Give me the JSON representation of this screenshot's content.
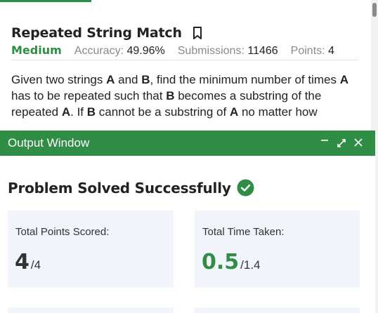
{
  "problem": {
    "title": "Repeated String Match",
    "difficulty": "Medium",
    "accuracy_label": "Accuracy:",
    "accuracy_value": "49.96%",
    "submissions_label": "Submissions:",
    "submissions_value": "11466",
    "points_label": "Points:",
    "points_value": "4",
    "description": {
      "p1": "Given two strings ",
      "a1": "A",
      "p2": " and ",
      "b1": "B",
      "p3": ", find the minimum number of times ",
      "a2": "A",
      "p4": " has to be repeated such that ",
      "b2": "B",
      "p5": " becomes a substring of the repeated ",
      "a3": "A",
      "p6": ". If ",
      "b3": "B",
      "p7": " cannot be a substring of ",
      "a4": "A",
      "p8": " no matter how"
    }
  },
  "output_window": {
    "title": "Output Window",
    "icons": [
      "minimize-icon",
      "expand-icon",
      "close-icon"
    ],
    "status": "Problem Solved Successfully",
    "cards": [
      {
        "label": "Total Points Scored:",
        "value": "4",
        "max": "/4"
      },
      {
        "label": "Total Time Taken:",
        "value": "0.5",
        "max": "/1.4"
      }
    ]
  },
  "colors": {
    "accent": "#2f8d46",
    "card_bg": "#f1f4fb"
  }
}
